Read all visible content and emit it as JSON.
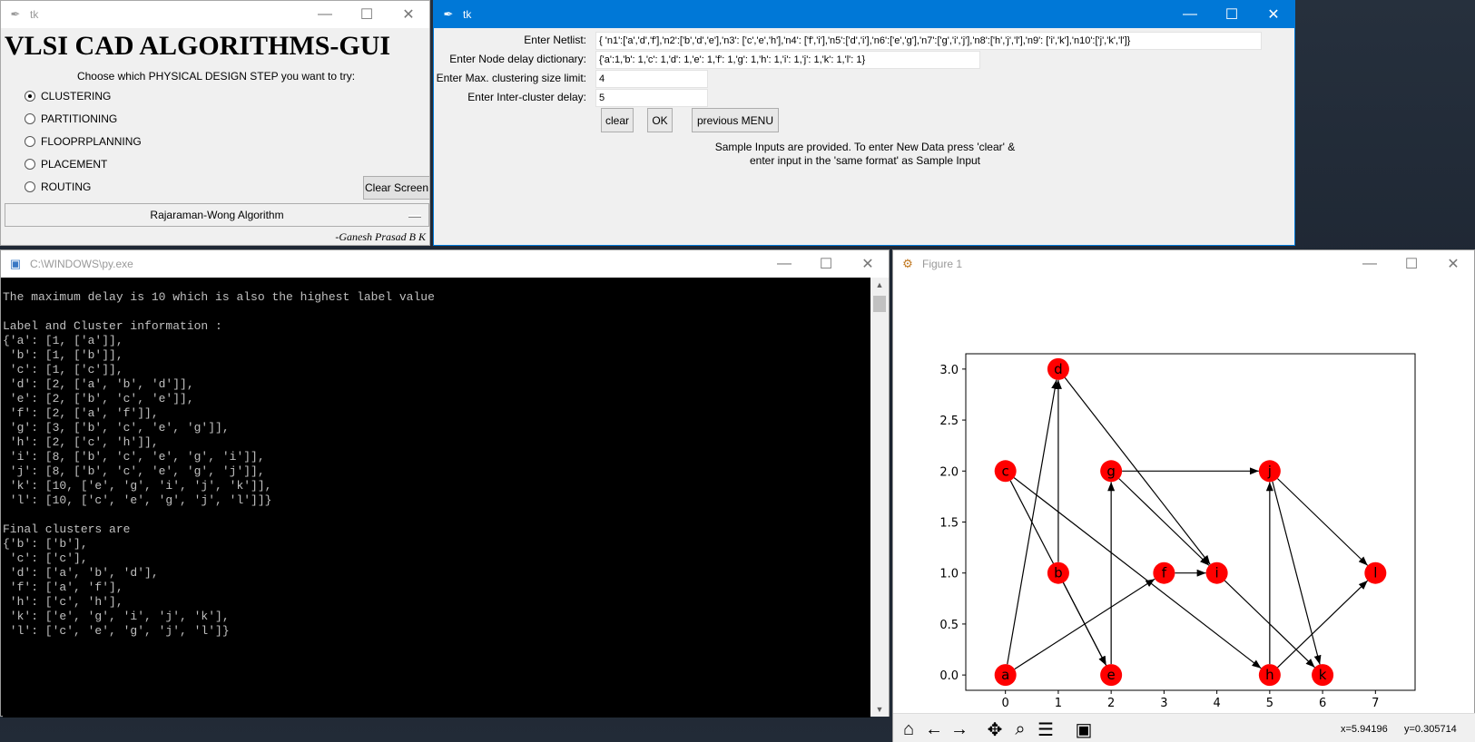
{
  "main_gui": {
    "window_title": "tk",
    "heading": "VLSI CAD ALGORITHMS-GUI",
    "prompt": "Choose which PHYSICAL DESIGN STEP you want to try:",
    "steps": [
      {
        "label": "CLUSTERING",
        "selected": true
      },
      {
        "label": "PARTITIONING",
        "selected": false
      },
      {
        "label": "FLOOPRPLANNING",
        "selected": false
      },
      {
        "label": "PLACEMENT",
        "selected": false
      },
      {
        "label": "ROUTING",
        "selected": false
      }
    ],
    "clear_screen_label": "Clear Screen",
    "algorithm_selected": "Rajaraman-Wong Algorithm",
    "author": "-Ganesh Prasad B K"
  },
  "input_form": {
    "window_title": "tk",
    "netlist_label": "Enter Netlist:",
    "netlist_value": "{ 'n1':['a','d','f'],'n2':['b','d','e'],'n3': ['c','e','h'],'n4': ['f','i'],'n5':['d','i'],'n6':['e','g'],'n7':['g','i','j'],'n8':['h','j','l'],'n9': ['i','k'],'n10':['j','k','l']}",
    "delay_label": "Enter Node delay dictionary:",
    "delay_value": "{'a':1,'b': 1,'c': 1,'d': 1,'e': 1,'f': 1,'g': 1,'h': 1,'i': 1,'j': 1,'k': 1,'l': 1}",
    "cluster_size_label": "Enter Max. clustering size limit:",
    "cluster_size_value": "4",
    "inter_delay_label": "Enter Inter-cluster delay:",
    "inter_delay_value": "5",
    "clear_label": "clear",
    "ok_label": "OK",
    "prev_menu_label": "previous MENU",
    "note_line1": "Sample Inputs are provided. To enter New Data press 'clear' &",
    "note_line2": "enter input in the 'same format' as Sample Input"
  },
  "console": {
    "window_title": "C:\\WINDOWS\\py.exe",
    "lines": [
      "The maximum delay is 10 which is also the highest label value",
      "",
      "Label and Cluster information :",
      "{'a': [1, ['a']],",
      " 'b': [1, ['b']],",
      " 'c': [1, ['c']],",
      " 'd': [2, ['a', 'b', 'd']],",
      " 'e': [2, ['b', 'c', 'e']],",
      " 'f': [2, ['a', 'f']],",
      " 'g': [3, ['b', 'c', 'e', 'g']],",
      " 'h': [2, ['c', 'h']],",
      " 'i': [8, ['b', 'c', 'e', 'g', 'i']],",
      " 'j': [8, ['b', 'c', 'e', 'g', 'j']],",
      " 'k': [10, ['e', 'g', 'i', 'j', 'k']],",
      " 'l': [10, ['c', 'e', 'g', 'j', 'l']]}",
      "",
      "Final clusters are",
      "{'b': ['b'],",
      " 'c': ['c'],",
      " 'd': ['a', 'b', 'd'],",
      " 'f': ['a', 'f'],",
      " 'h': ['c', 'h'],",
      " 'k': ['e', 'g', 'i', 'j', 'k'],",
      " 'l': ['c', 'e', 'g', 'j', 'l']}"
    ]
  },
  "figure": {
    "window_title": "Figure 1",
    "coord_x": "x=5.94196",
    "coord_y": "y=0.305714",
    "toolbar_icons": [
      "home-icon",
      "back-icon",
      "forward-icon",
      "pan-icon",
      "zoom-icon",
      "subplots-icon",
      "save-icon"
    ]
  },
  "chart_data": {
    "type": "scatter",
    "subtype": "directed-graph",
    "xlim": [
      -0.75,
      7.75
    ],
    "ylim": [
      -0.15,
      3.15
    ],
    "xticks": [
      "0",
      "1",
      "2",
      "3",
      "4",
      "5",
      "6",
      "7"
    ],
    "yticks": [
      "0.0",
      "0.5",
      "1.0",
      "1.5",
      "2.0",
      "2.5",
      "3.0"
    ],
    "grid": false,
    "node_color": "#ff0000",
    "nodes": [
      {
        "id": "a",
        "x": 0,
        "y": 0
      },
      {
        "id": "b",
        "x": 1,
        "y": 1
      },
      {
        "id": "c",
        "x": 0,
        "y": 2
      },
      {
        "id": "d",
        "x": 1,
        "y": 3
      },
      {
        "id": "e",
        "x": 2,
        "y": 0
      },
      {
        "id": "f",
        "x": 3,
        "y": 1
      },
      {
        "id": "g",
        "x": 2,
        "y": 2
      },
      {
        "id": "h",
        "x": 5,
        "y": 0
      },
      {
        "id": "i",
        "x": 4,
        "y": 1
      },
      {
        "id": "j",
        "x": 5,
        "y": 2
      },
      {
        "id": "k",
        "x": 6,
        "y": 0
      },
      {
        "id": "l",
        "x": 7,
        "y": 1
      }
    ],
    "edges": [
      [
        "a",
        "d"
      ],
      [
        "a",
        "f"
      ],
      [
        "b",
        "d"
      ],
      [
        "b",
        "e"
      ],
      [
        "c",
        "e"
      ],
      [
        "c",
        "h"
      ],
      [
        "d",
        "i"
      ],
      [
        "e",
        "g"
      ],
      [
        "f",
        "i"
      ],
      [
        "g",
        "i"
      ],
      [
        "g",
        "j"
      ],
      [
        "h",
        "j"
      ],
      [
        "h",
        "l"
      ],
      [
        "i",
        "k"
      ],
      [
        "j",
        "k"
      ],
      [
        "j",
        "l"
      ]
    ]
  }
}
